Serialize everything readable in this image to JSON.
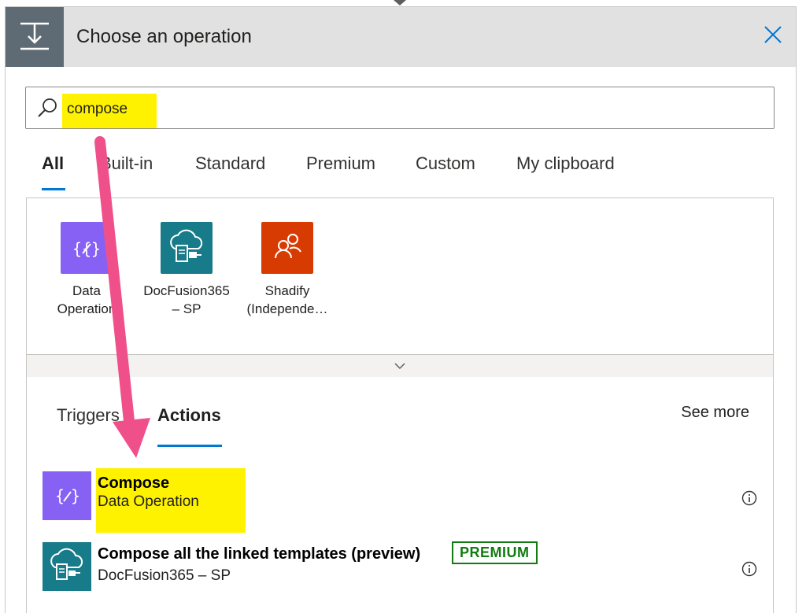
{
  "header": {
    "title": "Choose an operation",
    "icon": "data-operation-icon",
    "close_icon": "close-icon"
  },
  "search": {
    "value": "compose",
    "icon": "search-icon"
  },
  "tabs": [
    {
      "label": "All"
    },
    {
      "label": "Built-in"
    },
    {
      "label": "Standard"
    },
    {
      "label": "Premium"
    },
    {
      "label": "Custom"
    },
    {
      "label": "My clipboard"
    }
  ],
  "connectors": [
    {
      "label": "Data Operation",
      "color": "#8661f4"
    },
    {
      "label": "DocFusion365 – SP",
      "color": "#177b89"
    },
    {
      "label": "Shadify (Independe…",
      "color": "#d83b01"
    }
  ],
  "results": {
    "tabs": [
      {
        "label": "Triggers"
      },
      {
        "label": "Actions"
      }
    ],
    "see_more": "See more",
    "items": [
      {
        "title": "Compose",
        "subtitle": "Data Operation"
      },
      {
        "title": "Compose all the linked templates (preview)",
        "subtitle": "DocFusion365 – SP",
        "badge": "PREMIUM"
      }
    ]
  },
  "colors": {
    "accent": "#0078d4",
    "highlight": "#fff200",
    "arrow": "#f0508a",
    "premium": "#107c10"
  }
}
